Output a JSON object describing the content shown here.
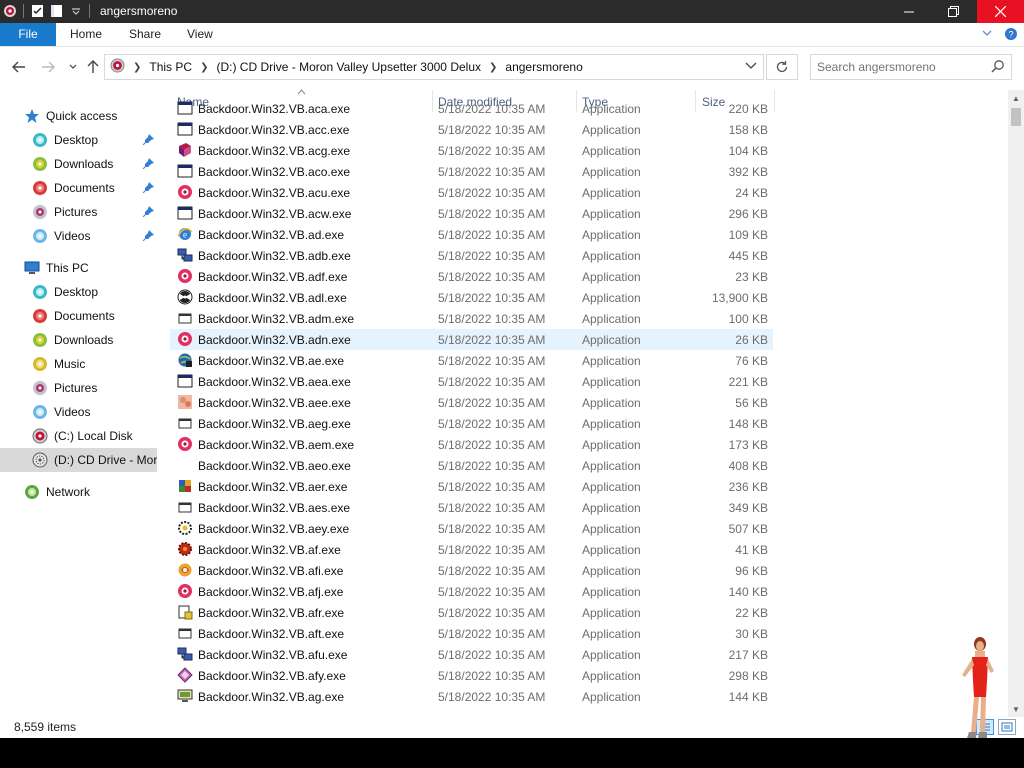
{
  "window": {
    "title": "angersmoreno",
    "controls": {
      "minimize": "—",
      "maximize": "❐",
      "close": "✕"
    }
  },
  "ribbon": {
    "tabs": [
      "File",
      "Home",
      "Share",
      "View"
    ]
  },
  "address": {
    "segments": [
      "This PC",
      "(D:) CD Drive - Moron Valley Upsetter 3000 Delux",
      "angersmoreno"
    ]
  },
  "search": {
    "placeholder": "Search angersmoreno"
  },
  "nav": {
    "items": [
      {
        "label": "Quick access",
        "icon": "star-icon",
        "pinned": false,
        "indent": 1
      },
      {
        "label": "Desktop",
        "icon": "desktop-icon",
        "pinned": true,
        "indent": 2
      },
      {
        "label": "Downloads",
        "icon": "downloads-icon",
        "pinned": true,
        "indent": 2
      },
      {
        "label": "Documents",
        "icon": "documents-icon",
        "pinned": true,
        "indent": 2
      },
      {
        "label": "Pictures",
        "icon": "pictures-icon",
        "pinned": true,
        "indent": 2
      },
      {
        "label": "Videos",
        "icon": "videos-icon",
        "pinned": true,
        "indent": 2
      },
      {
        "label": "This PC",
        "icon": "this-pc-icon",
        "pinned": false,
        "indent": 1
      },
      {
        "label": "Desktop",
        "icon": "desktop-icon",
        "pinned": false,
        "indent": 2
      },
      {
        "label": "Documents",
        "icon": "documents-icon",
        "pinned": false,
        "indent": 2
      },
      {
        "label": "Downloads",
        "icon": "downloads-icon",
        "pinned": false,
        "indent": 2
      },
      {
        "label": "Music",
        "icon": "music-icon",
        "pinned": false,
        "indent": 2
      },
      {
        "label": "Pictures",
        "icon": "pictures-icon",
        "pinned": false,
        "indent": 2
      },
      {
        "label": "Videos",
        "icon": "videos-icon",
        "pinned": false,
        "indent": 2
      },
      {
        "label": "(C:) Local Disk",
        "icon": "local-disk-icon",
        "pinned": false,
        "indent": 2
      },
      {
        "label": "(D:) CD Drive - Moron Valley Upsetter 3000 Delux",
        "icon": "cd-drive-icon",
        "pinned": false,
        "indent": 2,
        "selected": true
      },
      {
        "label": "Network",
        "icon": "network-icon",
        "pinned": false,
        "indent": 1
      }
    ]
  },
  "columns": {
    "name": "Name",
    "date": "Date modified",
    "type": "Type",
    "size": "Size"
  },
  "files": [
    {
      "name": "Backdoor.Win32.VB.aca.exe",
      "date": "5/18/2022 10:35 AM",
      "type": "Application",
      "size": "220 KB",
      "icon": "window-icon"
    },
    {
      "name": "Backdoor.Win32.VB.acc.exe",
      "date": "5/18/2022 10:35 AM",
      "type": "Application",
      "size": "158 KB",
      "icon": "window-icon"
    },
    {
      "name": "Backdoor.Win32.VB.acg.exe",
      "date": "5/18/2022 10:35 AM",
      "type": "Application",
      "size": "104 KB",
      "icon": "book-icon"
    },
    {
      "name": "Backdoor.Win32.VB.aco.exe",
      "date": "5/18/2022 10:35 AM",
      "type": "Application",
      "size": "392 KB",
      "icon": "window-icon"
    },
    {
      "name": "Backdoor.Win32.VB.acu.exe",
      "date": "5/18/2022 10:35 AM",
      "type": "Application",
      "size": "24 KB",
      "icon": "red-orb-icon"
    },
    {
      "name": "Backdoor.Win32.VB.acw.exe",
      "date": "5/18/2022 10:35 AM",
      "type": "Application",
      "size": "296 KB",
      "icon": "window-icon"
    },
    {
      "name": "Backdoor.Win32.VB.ad.exe",
      "date": "5/18/2022 10:35 AM",
      "type": "Application",
      "size": "109 KB",
      "icon": "ie-icon"
    },
    {
      "name": "Backdoor.Win32.VB.adb.exe",
      "date": "5/18/2022 10:35 AM",
      "type": "Application",
      "size": "445 KB",
      "icon": "network-pc-icon"
    },
    {
      "name": "Backdoor.Win32.VB.adf.exe",
      "date": "5/18/2022 10:35 AM",
      "type": "Application",
      "size": "23 KB",
      "icon": "red-orb-icon"
    },
    {
      "name": "Backdoor.Win32.VB.adl.exe",
      "date": "5/18/2022 10:35 AM",
      "type": "Application",
      "size": "13,900 KB",
      "icon": "radiation-icon"
    },
    {
      "name": "Backdoor.Win32.VB.adm.exe",
      "date": "5/18/2022 10:35 AM",
      "type": "Application",
      "size": "100 KB",
      "icon": "generic-exe-icon"
    },
    {
      "name": "Backdoor.Win32.VB.adn.exe",
      "date": "5/18/2022 10:35 AM",
      "type": "Application",
      "size": "26 KB",
      "icon": "red-orb-icon"
    },
    {
      "name": "Backdoor.Win32.VB.ae.exe",
      "date": "5/18/2022 10:35 AM",
      "type": "Application",
      "size": "76 KB",
      "icon": "globe-icon"
    },
    {
      "name": "Backdoor.Win32.VB.aea.exe",
      "date": "5/18/2022 10:35 AM",
      "type": "Application",
      "size": "221 KB",
      "icon": "window-icon"
    },
    {
      "name": "Backdoor.Win32.VB.aee.exe",
      "date": "5/18/2022 10:35 AM",
      "type": "Application",
      "size": "56 KB",
      "icon": "photo-icon"
    },
    {
      "name": "Backdoor.Win32.VB.aeg.exe",
      "date": "5/18/2022 10:35 AM",
      "type": "Application",
      "size": "148 KB",
      "icon": "generic-exe-icon"
    },
    {
      "name": "Backdoor.Win32.VB.aem.exe",
      "date": "5/18/2022 10:35 AM",
      "type": "Application",
      "size": "173 KB",
      "icon": "red-orb-icon"
    },
    {
      "name": "Backdoor.Win32.VB.aeo.exe",
      "date": "5/18/2022 10:35 AM",
      "type": "Application",
      "size": "408 KB",
      "icon": "blank-icon"
    },
    {
      "name": "Backdoor.Win32.VB.aer.exe",
      "date": "5/18/2022 10:35 AM",
      "type": "Application",
      "size": "236 KB",
      "icon": "colorful-app-icon"
    },
    {
      "name": "Backdoor.Win32.VB.aes.exe",
      "date": "5/18/2022 10:35 AM",
      "type": "Application",
      "size": "349 KB",
      "icon": "generic-exe-icon"
    },
    {
      "name": "Backdoor.Win32.VB.aey.exe",
      "date": "5/18/2022 10:35 AM",
      "type": "Application",
      "size": "507 KB",
      "icon": "gear-app-icon"
    },
    {
      "name": "Backdoor.Win32.VB.af.exe",
      "date": "5/18/2022 10:35 AM",
      "type": "Application",
      "size": "41 KB",
      "icon": "red-gear-icon"
    },
    {
      "name": "Backdoor.Win32.VB.afi.exe",
      "date": "5/18/2022 10:35 AM",
      "type": "Application",
      "size": "96 KB",
      "icon": "orange-swirl-icon"
    },
    {
      "name": "Backdoor.Win32.VB.afj.exe",
      "date": "5/18/2022 10:35 AM",
      "type": "Application",
      "size": "140 KB",
      "icon": "red-orb-icon"
    },
    {
      "name": "Backdoor.Win32.VB.afr.exe",
      "date": "5/18/2022 10:35 AM",
      "type": "Application",
      "size": "22 KB",
      "icon": "installer-icon"
    },
    {
      "name": "Backdoor.Win32.VB.aft.exe",
      "date": "5/18/2022 10:35 AM",
      "type": "Application",
      "size": "30 KB",
      "icon": "generic-exe-icon"
    },
    {
      "name": "Backdoor.Win32.VB.afu.exe",
      "date": "5/18/2022 10:35 AM",
      "type": "Application",
      "size": "217 KB",
      "icon": "network-pc-icon"
    },
    {
      "name": "Backdoor.Win32.VB.afy.exe",
      "date": "5/18/2022 10:35 AM",
      "type": "Application",
      "size": "298 KB",
      "icon": "diamond-icon"
    },
    {
      "name": "Backdoor.Win32.VB.ag.exe",
      "date": "5/18/2022 10:35 AM",
      "type": "Application",
      "size": "144 KB",
      "icon": "monitor-icon"
    }
  ],
  "hover_row": 11,
  "status": {
    "item_count": "8,559 items"
  },
  "colors": {
    "accent": "#1979ca",
    "titlebar": "#2b2b2b",
    "close": "#e81123",
    "hover_row": "#e5f3ff",
    "header_text": "#4d6082"
  }
}
